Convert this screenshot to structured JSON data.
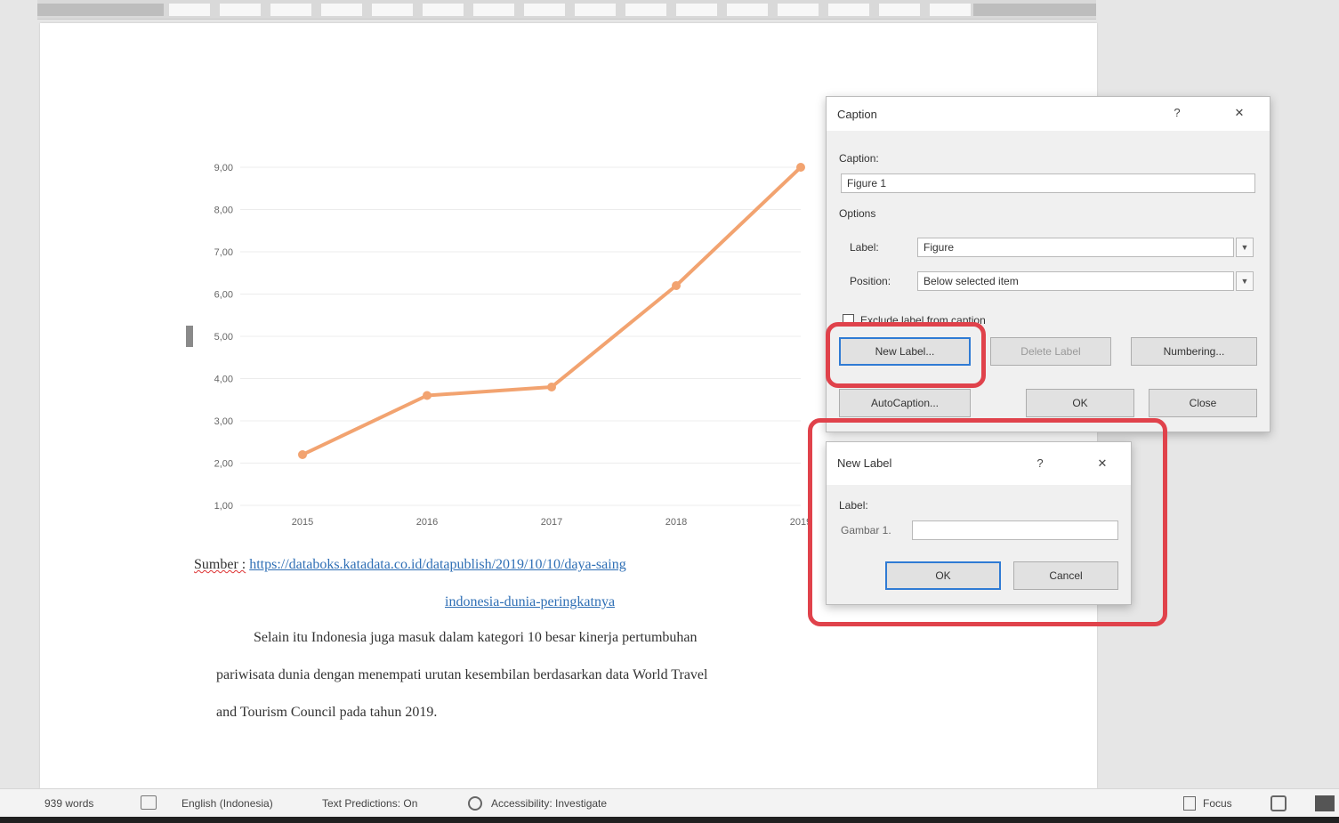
{
  "ruler": {},
  "chart_data": {
    "type": "line",
    "categories": [
      "2015",
      "2016",
      "2017",
      "2018",
      "2019"
    ],
    "series": [
      {
        "values": [
          2.2,
          3.6,
          3.8,
          6.2,
          9.0
        ],
        "color": "#f2a370"
      }
    ],
    "y_ticks": [
      "1,00",
      "2,00",
      "3,00",
      "4,00",
      "5,00",
      "6,00",
      "7,00",
      "8,00",
      "9,00"
    ],
    "ylim": [
      1,
      9
    ],
    "grid": true,
    "legend": "none",
    "title": "",
    "xlabel": "",
    "ylabel": ""
  },
  "document": {
    "source_label": "Sumber :",
    "source_url": "https://databoks.katadata.co.id/datapublish/2019/10/10/daya-saing",
    "source_url_cont": "indonesia-dunia-peringkatnya",
    "para_line1": "Selain itu Indonesia juga masuk dalam kategori 10 besar kinerja pertumbuhan",
    "para_line2": "pariwisata dunia dengan menempati urutan kesembilan berdasarkan data World Travel",
    "para_line3": "and Tourism Council pada tahun 2019."
  },
  "caption_dialog": {
    "title": "Caption",
    "help": "?",
    "close": "✕",
    "caption_section": "Caption:",
    "caption_value": "Figure 1",
    "options_section": "Options",
    "label_label": "Label:",
    "label_value": "Figure",
    "position_label": "Position:",
    "position_value": "Below selected item",
    "exclude_label": "Exclude label from caption",
    "new_label_button": "New Label...",
    "delete_label_button": "Delete Label",
    "numbering_button": "Numbering...",
    "autocaption_button": "AutoCaption...",
    "ok_button": "OK",
    "close_button": "Close"
  },
  "new_label_dialog": {
    "title": "New Label",
    "help": "?",
    "close": "✕",
    "label_section": "Label:",
    "label_prefix": "Gambar 1.",
    "label_value": "",
    "ok_button": "OK",
    "cancel_button": "Cancel"
  },
  "status_bar": {
    "words": "939 words",
    "language": "English (Indonesia)",
    "text_predictions": "Text Predictions: On",
    "accessibility": "Accessibility: Investigate",
    "focus": "Focus"
  },
  "colors": {
    "highlight": "#e0424b",
    "accent": "#2f7bd4",
    "series": "#f2a370"
  }
}
